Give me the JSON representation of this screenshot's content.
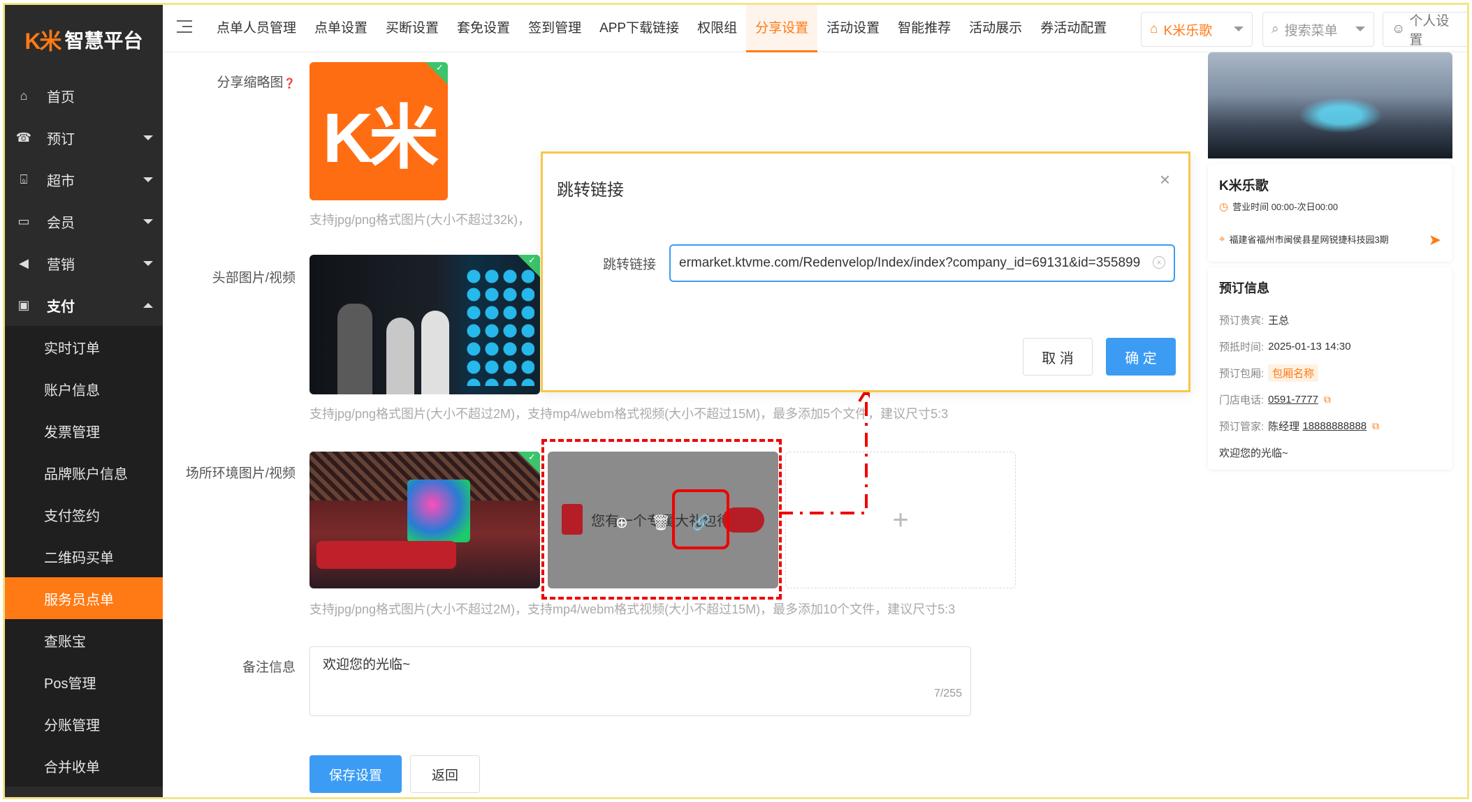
{
  "brand": {
    "logo_mark": "K米",
    "logo_text": "智慧平台",
    "accent": "#ff7a14",
    "primary": "#3c9cf4"
  },
  "sidebar": {
    "items": [
      {
        "label": "首页",
        "icon": "home-icon"
      },
      {
        "label": "预订",
        "icon": "booking-icon"
      },
      {
        "label": "超市",
        "icon": "basket-icon"
      },
      {
        "label": "会员",
        "icon": "card-icon"
      },
      {
        "label": "营销",
        "icon": "megaphone-icon"
      },
      {
        "label": "支付",
        "icon": "money-icon"
      }
    ],
    "sub_items": [
      "实时订单",
      "账户信息",
      "发票管理",
      "品牌账户信息",
      "支付签约",
      "二维码买单",
      "服务员点单",
      "查账宝",
      "Pos管理",
      "分账管理",
      "合并收单"
    ],
    "active_sub": "服务员点单"
  },
  "topbar": {
    "tabs": [
      "点单人员管理",
      "点单设置",
      "买断设置",
      "套免设置",
      "签到管理",
      "APP下载链接",
      "权限组",
      "分享设置",
      "活动设置",
      "智能推荐",
      "活动展示",
      "券活动配置"
    ],
    "active_tab": "分享设置",
    "store_select": "K米乐歌",
    "search_placeholder": "搜索菜单",
    "personal": "个人设置"
  },
  "form": {
    "share_thumb_label": "分享缩略图",
    "share_thumb_hint": "支持jpg/png格式图片(大小不超过32k)，",
    "header_media_label": "头部图片/视频",
    "header_media_hint": "支持jpg/png格式图片(大小不超过2M)，支持mp4/webm格式视频(大小不超过15M)，最多添加5个文件，建议尺寸5:3",
    "venue_media_label": "场所环境图片/视频",
    "venue_media_hint": "支持jpg/png格式图片(大小不超过2M)，支持mp4/webm格式视频(大小不超过15M)，最多添加10个文件，建议尺寸5:3",
    "banner_text": "您有一个专属大礼包待领取",
    "remark_label": "备注信息",
    "remark_value": "欢迎您的光临~",
    "remark_count": "7/255",
    "save_label": "保存设置",
    "back_label": "返回"
  },
  "dialog": {
    "title": "跳转链接",
    "field_label": "跳转链接",
    "field_value": "ermarket.ktvme.com/Redenvelop/Index/index?company_id=69131&id=355899",
    "cancel_label": "取 消",
    "ok_label": "确 定"
  },
  "preview": {
    "store_name": "K米乐歌",
    "hours": "营业时间 00:00-次日00:00",
    "address": "福建省福州市闽侯县星网锐捷科技园3期",
    "booking_title": "预订信息",
    "rows": [
      {
        "k": "预订贵宾:",
        "v": "王总"
      },
      {
        "k": "预抵时间:",
        "v": "2025-01-13 14:30"
      },
      {
        "k": "预订包厢:",
        "v": "包厢名称"
      },
      {
        "k": "门店电话:",
        "v": "0591-7777"
      },
      {
        "k": "预订管家:",
        "v": "陈经理",
        "v2": "18888888888"
      }
    ],
    "welcome": "欢迎您的光临~"
  }
}
